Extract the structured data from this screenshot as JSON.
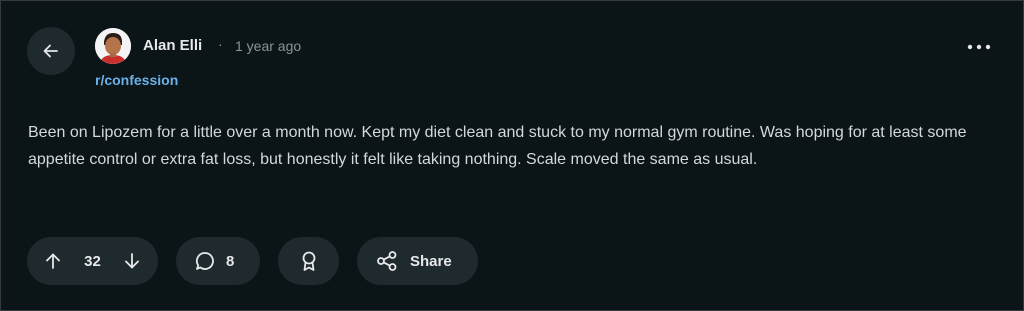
{
  "post": {
    "author": "Alan Elli",
    "separator": "·",
    "time_ago": "1 year ago",
    "subreddit": "r/confession",
    "body": "Been on Lipozem for a little over a month now. Kept my diet clean and stuck to my normal gym routine. Was hoping for at least some appetite control or extra fat loss, but honestly it felt like taking nothing. Scale moved the same as usual."
  },
  "actions": {
    "vote_count": "32",
    "comment_count": "8",
    "share_label": "Share"
  },
  "icons": {
    "back": "arrow-left-icon",
    "more": "more-horizontal-icon",
    "upvote": "arrow-up-icon",
    "downvote": "arrow-down-icon",
    "comment": "comment-bubble-icon",
    "award": "award-icon",
    "share": "share-icon"
  },
  "colors": {
    "background": "#0b1417",
    "pill": "#1f2a2e",
    "subreddit_link": "#6ab1ea",
    "muted_text": "#8b9499"
  }
}
